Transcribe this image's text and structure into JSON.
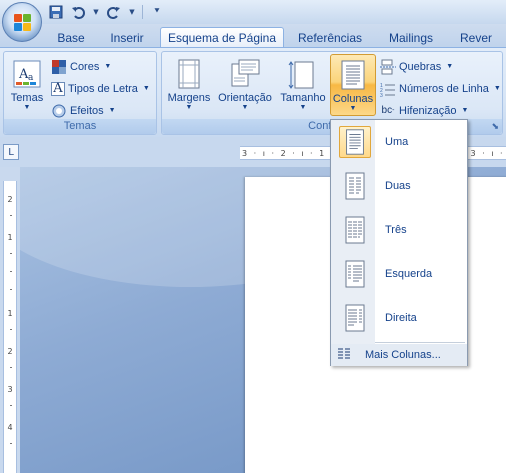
{
  "quick_access": {
    "icons": [
      "save-icon",
      "undo-icon",
      "redo-icon",
      "customize-icon"
    ]
  },
  "tabs": [
    {
      "label": "Base"
    },
    {
      "label": "Inserir"
    },
    {
      "label": "Esquema de Página",
      "active": true
    },
    {
      "label": "Referências"
    },
    {
      "label": "Mailings"
    },
    {
      "label": "Rever"
    }
  ],
  "ribbon": {
    "temas_group": {
      "label": "Temas",
      "temas_button": "Temas",
      "cores": "Cores",
      "tipos_de_letra": "Tipos de Letra",
      "efeitos": "Efeitos"
    },
    "config_group": {
      "label": "Configura",
      "margens": "Margens",
      "orientacao": "Orientação",
      "tamanho": "Tamanho",
      "colunas": "Colunas",
      "quebras": "Quebras",
      "numeros_de_linha": "Números de Linha",
      "hifenizacao": "Hifenização"
    }
  },
  "ruler": {
    "corner_symbol": "L",
    "horizontal": "3 · ı · 2 · ı · 1 · ı · ı · ı · 1 · ı · 2 · ı · 3 · ı · 4",
    "vertical_marks": [
      "2",
      "1",
      "1",
      "2",
      "3",
      "4"
    ]
  },
  "columns_menu": {
    "items": [
      {
        "label": "Uma",
        "selected": true
      },
      {
        "label": "Duas"
      },
      {
        "label": "Três"
      },
      {
        "label": "Esquerda"
      },
      {
        "label": "Direita"
      }
    ],
    "more": "Mais Colunas..."
  },
  "colors": {
    "accent_text": "#15428b",
    "hover_orange": "#f8b844",
    "ribbon_bg": "#dbe7f6"
  }
}
